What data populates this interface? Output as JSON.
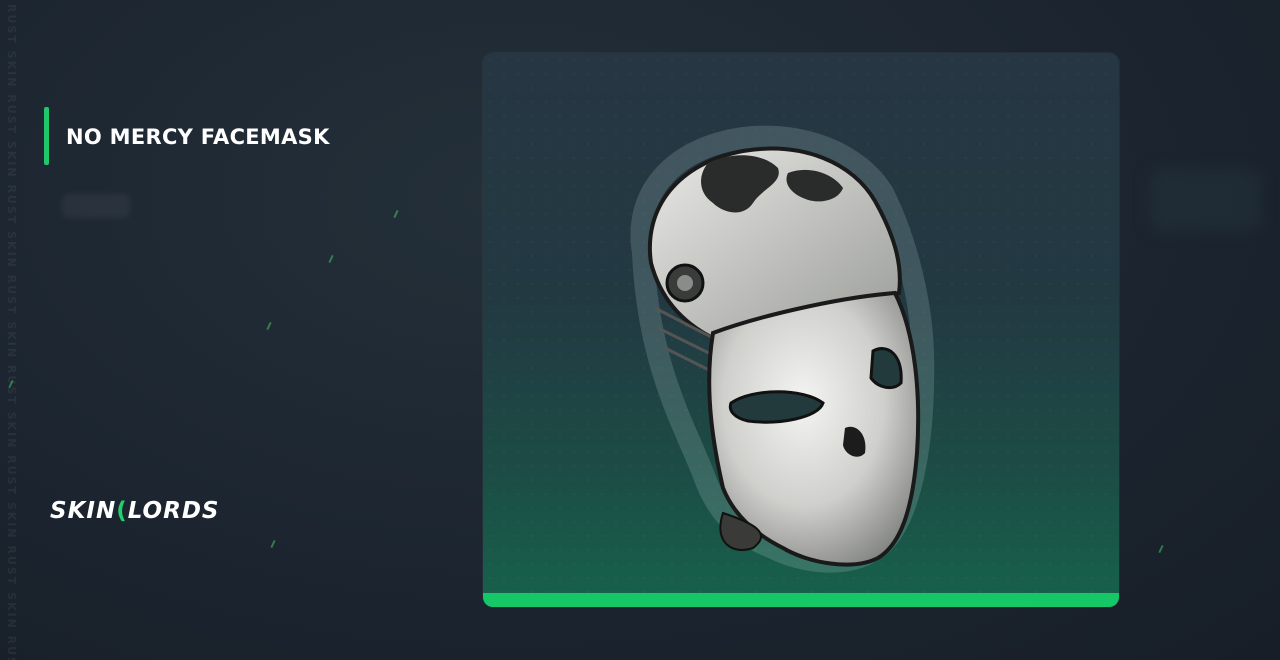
{
  "item": {
    "name": "NO MERCY FACEMASK",
    "image_icon": "skull-facemask-icon"
  },
  "brand": {
    "logo_text_left": "SKIN",
    "logo_text_right": "LORDS",
    "watermark": "RUST SKIN RUST SKIN RUST SKIN RUST SKIN RUST SKIN RUST SKIN RUST SKIN RUST"
  },
  "colors": {
    "accent": "#1fc66a",
    "background": "#1c2530",
    "card_top": "#263642",
    "card_bottom": "#17624c"
  }
}
